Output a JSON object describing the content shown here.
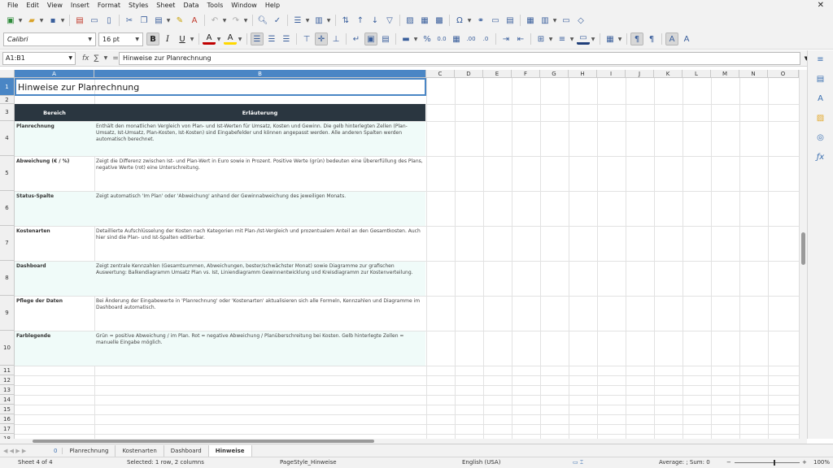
{
  "menu": [
    "File",
    "Edit",
    "View",
    "Insert",
    "Format",
    "Styles",
    "Sheet",
    "Data",
    "Tools",
    "Window",
    "Help"
  ],
  "menu_close": "✕",
  "toolbar": {
    "font_name": "Calibri",
    "font_size": "16 pt",
    "bold": "B",
    "italic": "I",
    "underline": "U",
    "font_color_letter": "A",
    "highlight_letter": "A",
    "percent": "%",
    "decimal": "0.0",
    "decimals_add": ".00",
    "decimals_remove": ".0"
  },
  "formula": {
    "name_box": "A1:B1",
    "fx": "fx",
    "sigma": "∑",
    "equals": "=",
    "content": "Hinweise zur Planrechnung"
  },
  "columns": [
    "A",
    "B",
    "C",
    "D",
    "E",
    "F",
    "G",
    "H",
    "I",
    "J",
    "K",
    "L",
    "M",
    "N",
    "O"
  ],
  "rows": [
    "1",
    "2",
    "3",
    "4",
    "5",
    "6",
    "7",
    "8",
    "9",
    "10",
    "11",
    "12",
    "13",
    "14",
    "15",
    "16",
    "17",
    "18"
  ],
  "sheet": {
    "title": "Hinweise zur Planrechnung",
    "header_bereich": "Bereich",
    "header_erlaeuterung": "Erläuterung",
    "entries": [
      {
        "bereich": "Planrechnung",
        "text": "Enthält den monatlichen Vergleich von Plan- und Ist-Werten für Umsatz, Kosten und Gewinn. Die gelb hinterlegten Zellen (Plan-Umsatz, Ist-Umsatz, Plan-Kosten, Ist-Kosten) sind Eingabefelder und können angepasst werden. Alle anderen Spalten werden automatisch berechnet."
      },
      {
        "bereich": "Abweichung (€ / %)",
        "text": "Zeigt die Differenz zwischen Ist- und Plan-Wert in Euro sowie in Prozent. Positive Werte (grün) bedeuten eine Übererfüllung des Plans, negative Werte (rot) eine Unterschreitung."
      },
      {
        "bereich": "Status-Spalte",
        "text": "Zeigt automatisch 'Im Plan' oder 'Abweichung' anhand der Gewinnabweichung des jeweiligen Monats."
      },
      {
        "bereich": "Kostenarten",
        "text": "Detaillierte Aufschlüsselung der Kosten nach Kategorien mit Plan-/Ist-Vergleich und prozentualem Anteil an den Gesamtkosten. Auch hier sind die Plan- und Ist-Spalten editierbar."
      },
      {
        "bereich": "Dashboard",
        "text": "Zeigt zentrale Kennzahlen (Gesamtsummen, Abweichungen, bester/schwächster Monat) sowie Diagramme zur grafischen Auswertung: Balkendiagramm Umsatz Plan vs. Ist, Liniendiagramm Gewinnentwicklung und Kreisdiagramm zur Kostenverteilung."
      },
      {
        "bereich": "Pflege der Daten",
        "text": "Bei Änderung der Eingabewerte in 'Planrechnung' oder 'Kostenarten' aktualisieren sich alle Formeln, Kennzahlen und Diagramme im Dashboard automatisch."
      },
      {
        "bereich": "Farblegende",
        "text": "Grün = positive Abweichung / im Plan. Rot = negative Abweichung / Planüberschreitung bei Kosten. Gelb hinterlegte Zellen = manuelle Eingabe möglich."
      }
    ]
  },
  "tabs": {
    "add": "0",
    "names": [
      "Planrechnung",
      "Kostenarten",
      "Dashboard",
      "Hinweise"
    ],
    "active_index": 3
  },
  "status": {
    "sheet": "Sheet 4 of 4",
    "selection": "Selected: 1 row, 2 columns",
    "page_style": "PageStyle_Hinweise",
    "language": "English (USA)",
    "sum": "Average: ; Sum: 0",
    "zoom": "100%"
  }
}
